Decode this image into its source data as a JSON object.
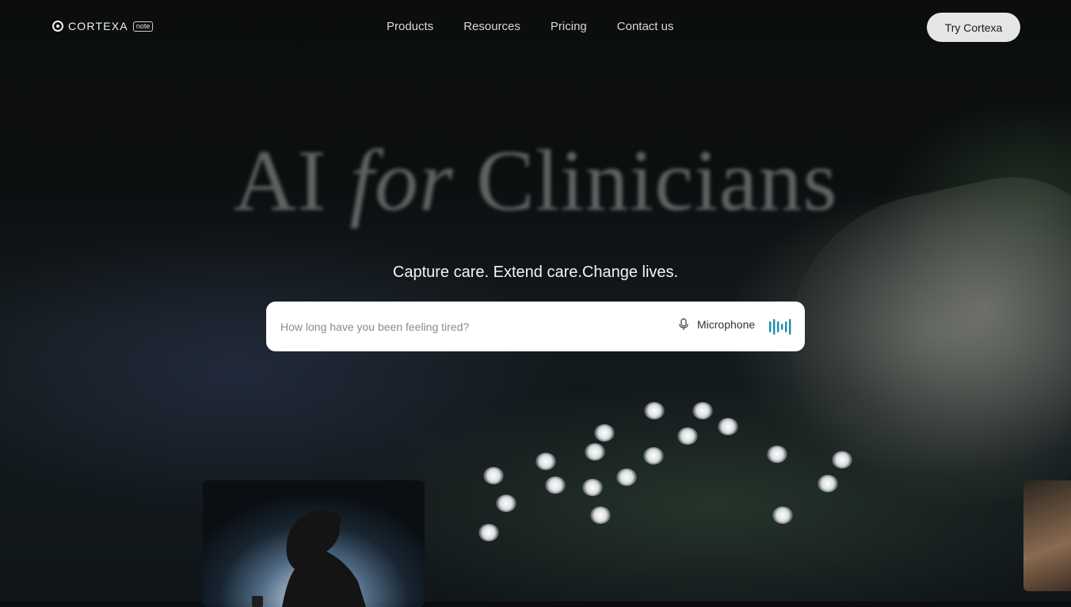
{
  "nav": {
    "logo_text": "CORTEXA",
    "logo_badge": "note",
    "links": [
      "Products",
      "Resources",
      "Pricing",
      "Contact us"
    ],
    "cta": "Try Cortexa"
  },
  "hero": {
    "title_part1": "AI",
    "title_part2": "for",
    "title_part3": "Clinicians",
    "tagline": "Capture care. Extend care.Change lives."
  },
  "search": {
    "placeholder": "How long have you been feeling tired?",
    "mic_label": "Microphone"
  },
  "colors": {
    "accent": "#1a8fa8",
    "cta_bg": "#e6e6e6"
  }
}
